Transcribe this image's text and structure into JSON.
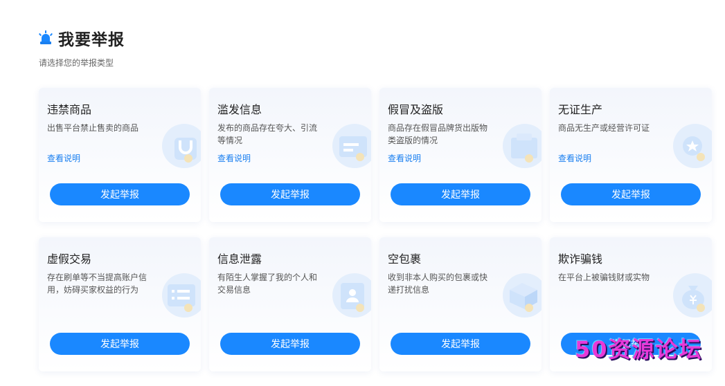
{
  "page": {
    "title": "我要举报",
    "subtitle": "请选择您的举报类型"
  },
  "cards": [
    {
      "title": "违禁商品",
      "desc": "出售平台禁止售卖的商品",
      "link": "查看说明",
      "button": "发起举报",
      "art": "bag-icon"
    },
    {
      "title": "滥发信息",
      "desc": "发布的商品存在夸大、引流等情况",
      "link": "查看说明",
      "button": "发起举报",
      "art": "message-card-icon"
    },
    {
      "title": "假冒及盗版",
      "desc": "商品存在假冒品牌货出版物类盗版的情况",
      "link": "查看说明",
      "button": "发起举报",
      "art": "box-icon"
    },
    {
      "title": "无证生产",
      "desc": "商品无生产或经营许可证",
      "link": "查看说明",
      "button": "发起举报",
      "art": "certificate-icon"
    },
    {
      "title": "虚假交易",
      "desc": "存在刷单等不当提高账户信用，妨碍买家权益的行为",
      "link": "",
      "button": "发起举报",
      "art": "document-icon"
    },
    {
      "title": "信息泄露",
      "desc": "有陌生人掌握了我的个人和交易信息",
      "link": "",
      "button": "发起举报",
      "art": "id-card-icon"
    },
    {
      "title": "空包裹",
      "desc": "收到非本人购买的包裹或快递打扰信息",
      "link": "",
      "button": "发起举报",
      "art": "open-box-icon"
    },
    {
      "title": "欺诈骗钱",
      "desc": "在平台上被骗钱财或实物",
      "link": "",
      "button": "发起举报",
      "art": "money-bag-icon"
    }
  ],
  "watermark": "50资源论坛",
  "colors": {
    "accent": "#1a88ff",
    "link": "#1a7ff0"
  }
}
